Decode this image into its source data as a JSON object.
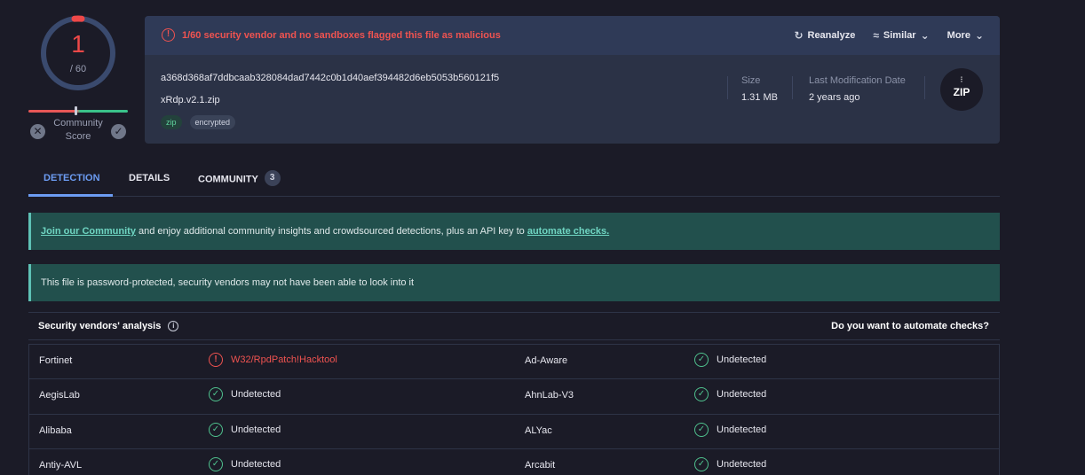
{
  "score": {
    "detections": "1",
    "total": "/ 60",
    "community_label": "Community Score"
  },
  "alert": {
    "text": "1/60 security vendor and no sandboxes flagged this file as malicious"
  },
  "actions": [
    {
      "label": "Reanalyze",
      "icon": "refresh-icon"
    },
    {
      "label": "Similar",
      "icon": "similar-icon"
    },
    {
      "label": "More",
      "icon": "chevron-down-icon"
    }
  ],
  "file": {
    "hash": "a368d368af7ddbcaab328084dad7442c0b1d40aef394482d6eb5053b560121f5",
    "name": "xRdp.v2.1.zip",
    "tags": [
      "zip",
      "encrypted"
    ],
    "size_label": "Size",
    "size": "1.31 MB",
    "date_label": "Last Modification Date",
    "date": "2 years ago",
    "type_icon": "ZIP"
  },
  "tabs": [
    {
      "label": "DETECTION"
    },
    {
      "label": "DETAILS"
    },
    {
      "label": "COMMUNITY",
      "badge": "3"
    }
  ],
  "banners": {
    "community_link": "Join our Community",
    "community_text": " and enjoy additional community insights and crowdsourced detections, plus an API key to ",
    "automate_link": "automate checks.",
    "password_text": "This file is password-protected, security vendors may not have been able to look into it"
  },
  "vendors_section": {
    "title": "Security vendors' analysis",
    "cta": "Do you want to automate checks?"
  },
  "vendors": [
    {
      "v1": "Fortinet",
      "r1": "W32/RpdPatch!Hacktool",
      "r1_malicious": true,
      "v2": "Ad-Aware",
      "r2": "Undetected"
    },
    {
      "v1": "AegisLab",
      "r1": "Undetected",
      "r1_malicious": false,
      "v2": "AhnLab-V3",
      "r2": "Undetected"
    },
    {
      "v1": "Alibaba",
      "r1": "Undetected",
      "r1_malicious": false,
      "v2": "ALYac",
      "r2": "Undetected"
    },
    {
      "v1": "Antiy-AVL",
      "r1": "Undetected",
      "r1_malicious": false,
      "v2": "Arcabit",
      "r2": "Undetected"
    }
  ],
  "colors": {
    "malicious": "#ef5350",
    "clean": "#4fc28e",
    "accent": "#6c9cf2",
    "banner_bg": "#22504d"
  }
}
